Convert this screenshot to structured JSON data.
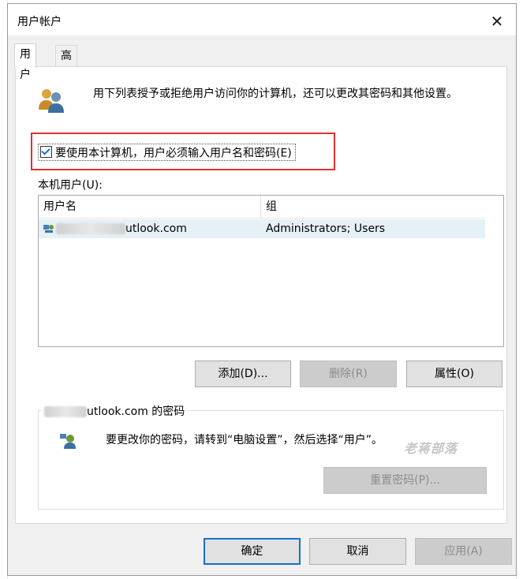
{
  "window": {
    "title": "用户帐户",
    "close_symbol": "✕"
  },
  "tabs": [
    {
      "label": "用户",
      "active": true
    },
    {
      "label": "高级",
      "active": false
    }
  ],
  "intro": {
    "text": "用下列表授予或拒绝用户访问你的计算机，还可以更改其密码和其他设置。"
  },
  "require_login": {
    "label": "要使用本计算机，用户必须输入用户名和密码(E)",
    "checked": true
  },
  "users": {
    "label": "本机用户(U):",
    "columns": [
      "用户名",
      "组"
    ],
    "rows": [
      {
        "username_visible": "utlook.com",
        "group": "Administrators; Users",
        "icon": "user-network-icon"
      }
    ]
  },
  "user_buttons": {
    "add": "添加(D)...",
    "remove": "删除(R)",
    "properties": "属性(O)"
  },
  "password_group": {
    "title_visible": "utlook.com 的密码",
    "text": "要更改你的密码，请转到“电脑设置”，然后选择“用户”。",
    "reset_button": "重置密码(P)...",
    "icon": "user-key-icon"
  },
  "watermark": "老蒋部落",
  "footer_buttons": {
    "ok": "确定",
    "cancel": "取消",
    "apply": "应用(A)"
  },
  "colors": {
    "accent_blue": "#1a6fd0",
    "highlight_red": "#e03030",
    "selected_row": "#e5f0f7"
  }
}
